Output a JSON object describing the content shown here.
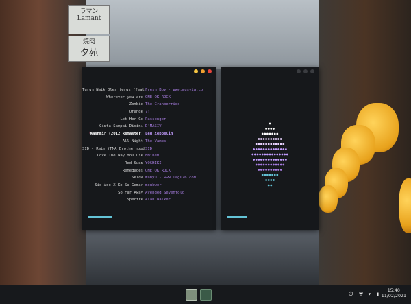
{
  "playlist": {
    "tracks": [
      {
        "title": "Turun Naik Oles terus (feat",
        "artist": "Fresh Boy - www.musvia.co",
        "current": false
      },
      {
        "title": "Wherever you are",
        "artist": "ONE OK ROCK",
        "current": false
      },
      {
        "title": "Zombie",
        "artist": "The Cranberries",
        "current": false
      },
      {
        "title": "Orange",
        "artist": "7!!",
        "current": false
      },
      {
        "title": "Let Her Go",
        "artist": "Passenger",
        "current": false
      },
      {
        "title": "Cinta Sampai Disini",
        "artist": "D'MASIV",
        "current": false
      },
      {
        "title": "Kashmir (2012 Remaster)",
        "artist": "Led Zeppelin",
        "current": true
      },
      {
        "title": "All Night",
        "artist": "The Vamps",
        "current": false
      },
      {
        "title": "SID - Rain (FMA Brotherhood",
        "artist": "SID",
        "current": false
      },
      {
        "title": "Love The Way You Lie",
        "artist": "Eminem",
        "current": false
      },
      {
        "title": "Red Swan",
        "artist": "YOSHIKI",
        "current": false
      },
      {
        "title": "Renegades",
        "artist": "ONE OK ROCK",
        "current": false
      },
      {
        "title": "Selow",
        "artist": "Wahyu - www.lagu76.com",
        "current": false
      },
      {
        "title": "Sio Ado X Ko Sa Gemar",
        "artist": "moukwer",
        "current": false
      },
      {
        "title": "So Far Away",
        "artist": "Avenged Sevenfold",
        "current": false
      },
      {
        "title": "Spectre",
        "artist": "Alan Walker",
        "current": false
      }
    ],
    "current_marker": "›",
    "progress": 0.18
  },
  "visualizer": {
    "progress": 0.2
  },
  "window_buttons": {
    "active": [
      "#f5c542",
      "#f0a030",
      "#e8453c"
    ],
    "inactive": [
      "#3a3c40",
      "#3a3c40",
      "#3a3c40"
    ]
  },
  "wallpaper_signs": {
    "sign1": "ラマン",
    "sign1b": "Lamant",
    "sign2": "焼肉",
    "sign2b": "夕苑"
  },
  "taskbar": {
    "apps": [
      "file-manager",
      "terminal"
    ],
    "tray_icons": [
      "power-icon",
      "shield-icon",
      "wifi-icon",
      "battery-icon"
    ],
    "time": "15:40",
    "date": "11/02/2021"
  },
  "colors": {
    "accent": "#a77de0",
    "progress": "#63c3d6",
    "visualizer": [
      "#ffffff",
      "#e9d3ff",
      "#c39cff",
      "#a77de0",
      "#63c3d6"
    ]
  }
}
